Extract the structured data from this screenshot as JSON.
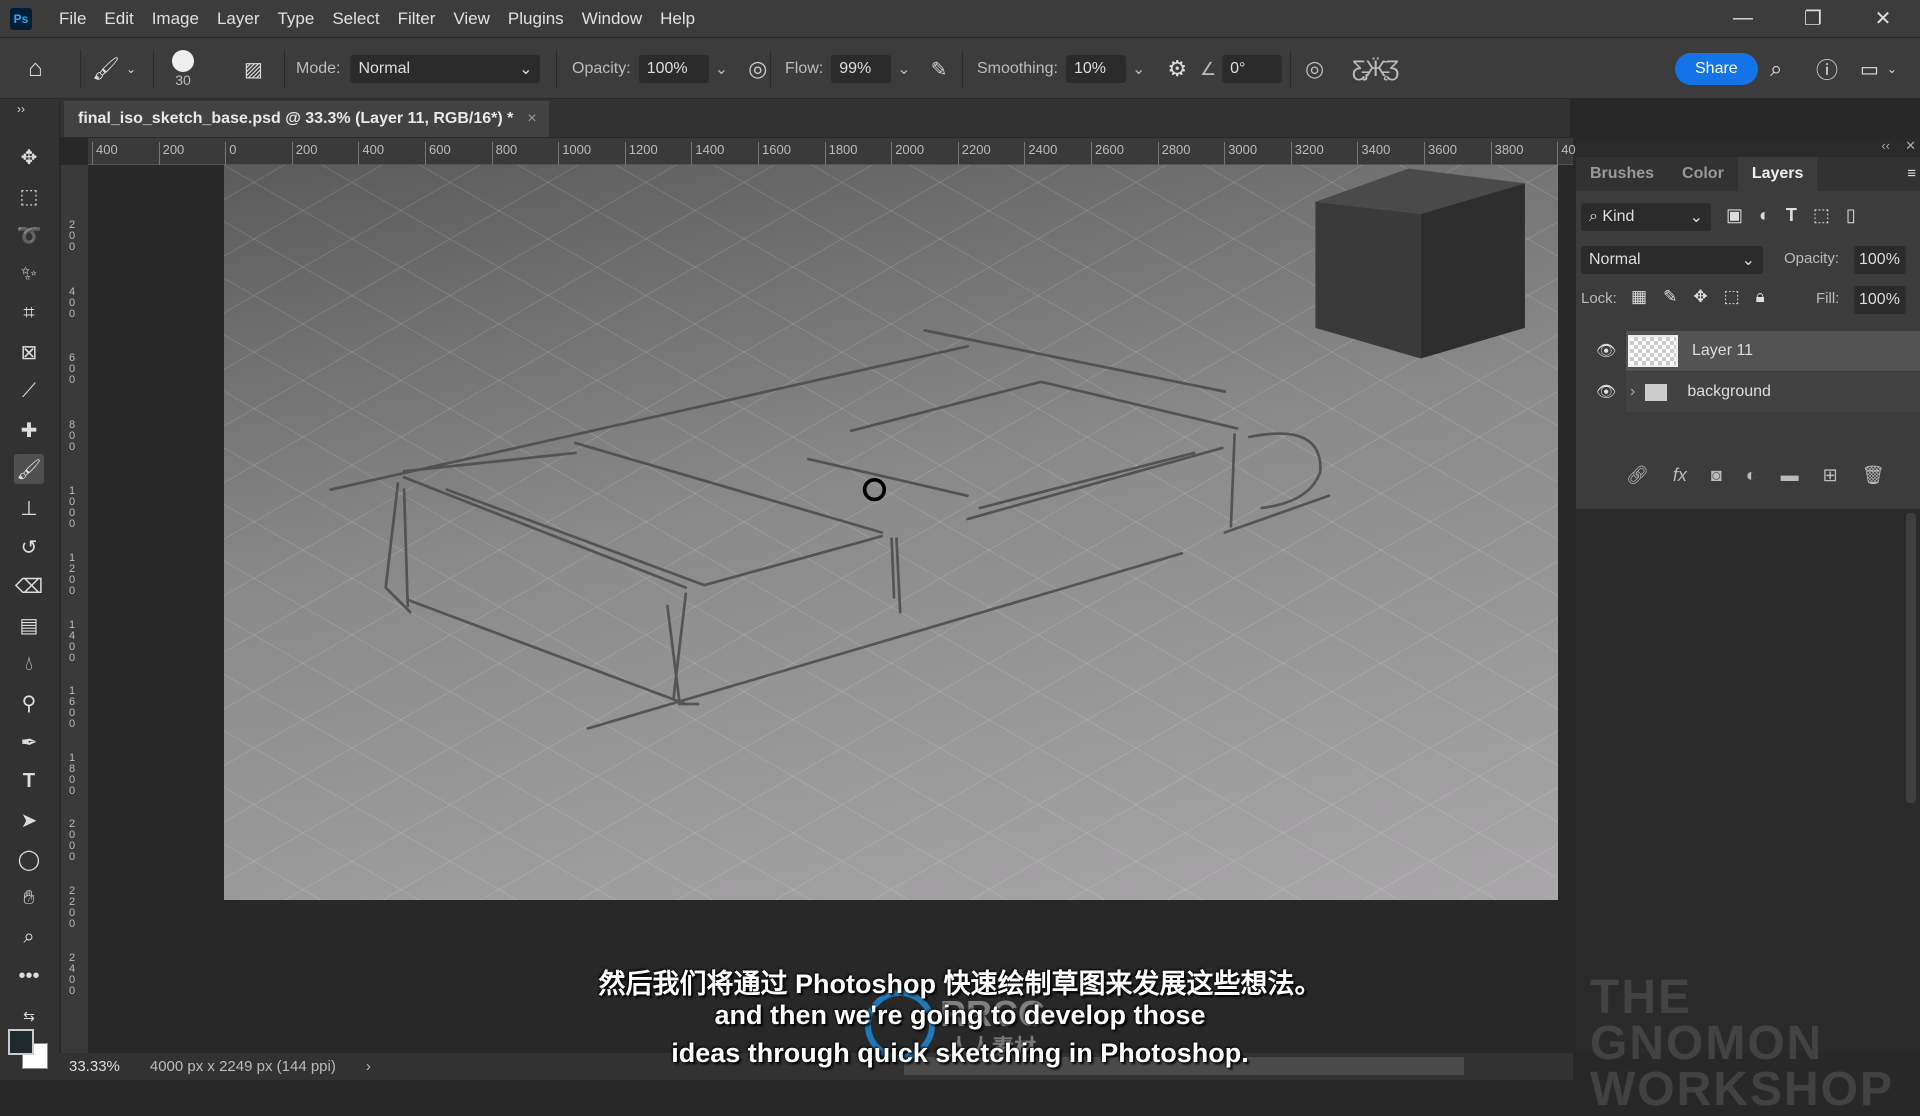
{
  "app": {
    "logo": "Ps"
  },
  "menu": [
    "File",
    "Edit",
    "Image",
    "Layer",
    "Type",
    "Select",
    "Filter",
    "View",
    "Plugins",
    "Window",
    "Help"
  ],
  "options": {
    "brush_size": "30",
    "mode_label": "Mode:",
    "mode_value": "Normal",
    "opacity_label": "Opacity:",
    "opacity_value": "100%",
    "flow_label": "Flow:",
    "flow_value": "99%",
    "smoothing_label": "Smoothing:",
    "smoothing_value": "10%",
    "angle_value": "0°",
    "share_label": "Share"
  },
  "document": {
    "tab_title": "final_iso_sketch_base.psd @ 33.3% (Layer 11, RGB/16*) *"
  },
  "ruler": {
    "h_ticks": [
      "400",
      "200",
      "0",
      "200",
      "400",
      "600",
      "800",
      "1000",
      "1200",
      "1400",
      "1600",
      "1800",
      "2000",
      "2200",
      "2400",
      "2600",
      "2800",
      "3000",
      "3200",
      "3400",
      "3600",
      "3800",
      "40"
    ],
    "v_ticks": [
      "2\n0\n0",
      "4\n0\n0",
      "6\n0\n0",
      "8\n0\n0",
      "1\n0\n0\n0",
      "1\n2\n0\n0",
      "1\n4\n0\n0",
      "1\n6\n0\n0",
      "1\n8\n0\n0",
      "2\n0\n0\n0",
      "2\n2\n0\n0",
      "2\n4\n0\n0"
    ]
  },
  "panel": {
    "tabs": [
      "Brushes",
      "Color",
      "Layers"
    ],
    "active_tab": "Layers",
    "filter_kind": "Kind",
    "blend_mode": "Normal",
    "opacity_label": "Opacity:",
    "opacity_value": "100%",
    "lock_label": "Lock:",
    "fill_label": "Fill:",
    "fill_value": "100%",
    "layers": [
      {
        "name": "Layer 11",
        "selected": true,
        "visible": true
      },
      {
        "name": "background",
        "type": "group",
        "visible": true
      }
    ]
  },
  "status": {
    "zoom": "33.33%",
    "doc_info": "4000 px x 2249 px (144 ppi)"
  },
  "subtitles": [
    "然后我们将通过 Photoshop 快速绘制草图来发展这些想法。",
    "and then we're going to develop those",
    "ideas through quick sketching in Photoshop."
  ],
  "watermarks": {
    "rrcg": "RRCG",
    "rrcg_cn": "人人素材",
    "gnomon": "THE GNOMON WORKSHOP"
  },
  "colors": {
    "accent": "#1473e6",
    "ps_blue": "#31a8ff"
  }
}
